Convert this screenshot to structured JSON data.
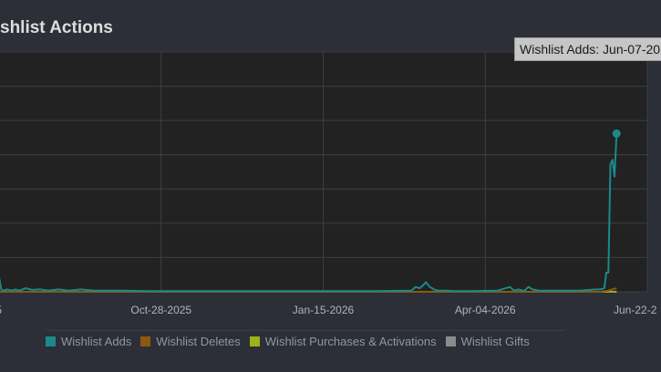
{
  "title": "shlist Actions",
  "tooltip": {
    "text": "Wishlist Adds: Jun-07-202"
  },
  "colors": {
    "background": "#2c2f37",
    "plot_background": "#222222",
    "grid": "#3c3f44",
    "wishlist_adds": "#1a8a8a",
    "wishlist_deletes": "#8a5a12",
    "wishlist_purchases": "#9cb219",
    "wishlist_gifts": "#8c8c8c"
  },
  "chart_data": {
    "type": "line",
    "title": "shlist Actions",
    "xlabel": "",
    "ylabel": "",
    "x_tick_labels": [
      "5",
      "Oct-28-2025",
      "Jan-15-2026",
      "Apr-04-2026",
      "Jun-22-2"
    ],
    "x_tick_dates": [
      "2025-08-10",
      "2025-10-28",
      "2026-01-15",
      "2026-04-04",
      "2026-06-22"
    ],
    "xlim": [
      "2025-08-10",
      "2026-06-22"
    ],
    "ylim": [
      0,
      100
    ],
    "grid": true,
    "legend_position": "bottom",
    "legend": [
      "Wishlist Adds",
      "Wishlist Deletes",
      "Wishlist Purchases & Activations",
      "Wishlist Gifts"
    ],
    "series": [
      {
        "name": "Wishlist Adds",
        "color": "#1a8a8a",
        "x": [
          "2025-08-10",
          "2025-08-11",
          "2025-08-12",
          "2025-08-14",
          "2025-08-16",
          "2025-08-18",
          "2025-08-20",
          "2025-08-23",
          "2025-08-26",
          "2025-08-30",
          "2025-09-03",
          "2025-09-08",
          "2025-09-13",
          "2025-09-19",
          "2025-09-25",
          "2025-10-02",
          "2025-10-10",
          "2025-10-20",
          "2025-11-01",
          "2025-11-20",
          "2025-12-10",
          "2026-01-01",
          "2026-01-20",
          "2026-02-10",
          "2026-02-27",
          "2026-03-01",
          "2026-03-03",
          "2026-03-05",
          "2026-03-06",
          "2026-03-08",
          "2026-03-10",
          "2026-03-12",
          "2026-03-15",
          "2026-03-20",
          "2026-03-28",
          "2026-04-10",
          "2026-04-16",
          "2026-04-18",
          "2026-04-20",
          "2026-04-23",
          "2026-04-25",
          "2026-04-27",
          "2026-04-30",
          "2026-05-10",
          "2026-05-20",
          "2026-05-28",
          "2026-05-30",
          "2026-06-01",
          "2026-06-02",
          "2026-06-03",
          "2026-06-04",
          "2026-06-05",
          "2026-06-06",
          "2026-06-07"
        ],
        "values": [
          6,
          1,
          0.5,
          1,
          0.5,
          1,
          0.5,
          1.5,
          0.8,
          1,
          0.5,
          1,
          0.5,
          1,
          0.5,
          0.5,
          0.5,
          0.3,
          0.3,
          0.3,
          0.3,
          0.3,
          0.3,
          0.3,
          0.5,
          2,
          1.5,
          3,
          4,
          2,
          1,
          0.5,
          0.5,
          0.3,
          0.3,
          0.5,
          2,
          0.5,
          1,
          0.3,
          2,
          1,
          0.5,
          0.5,
          0.5,
          1,
          1,
          1.5,
          8,
          8,
          53,
          55,
          48,
          66
        ]
      },
      {
        "name": "Wishlist Deletes",
        "color": "#8a5a12",
        "x": [
          "2025-08-10",
          "2026-05-30",
          "2026-06-03",
          "2026-06-07"
        ],
        "values": [
          0,
          0,
          0.5,
          1.5
        ]
      },
      {
        "name": "Wishlist Purchases & Activations",
        "color": "#9cb219",
        "x": [
          "2025-08-10",
          "2026-06-07"
        ],
        "values": [
          0,
          0
        ]
      },
      {
        "name": "Wishlist Gifts",
        "color": "#8c8c8c",
        "x": [
          "2025-08-10",
          "2026-06-07"
        ],
        "values": [
          0,
          0
        ]
      }
    ],
    "highlight": {
      "series": "Wishlist Adds",
      "x": "2026-06-07",
      "y": 66
    }
  }
}
